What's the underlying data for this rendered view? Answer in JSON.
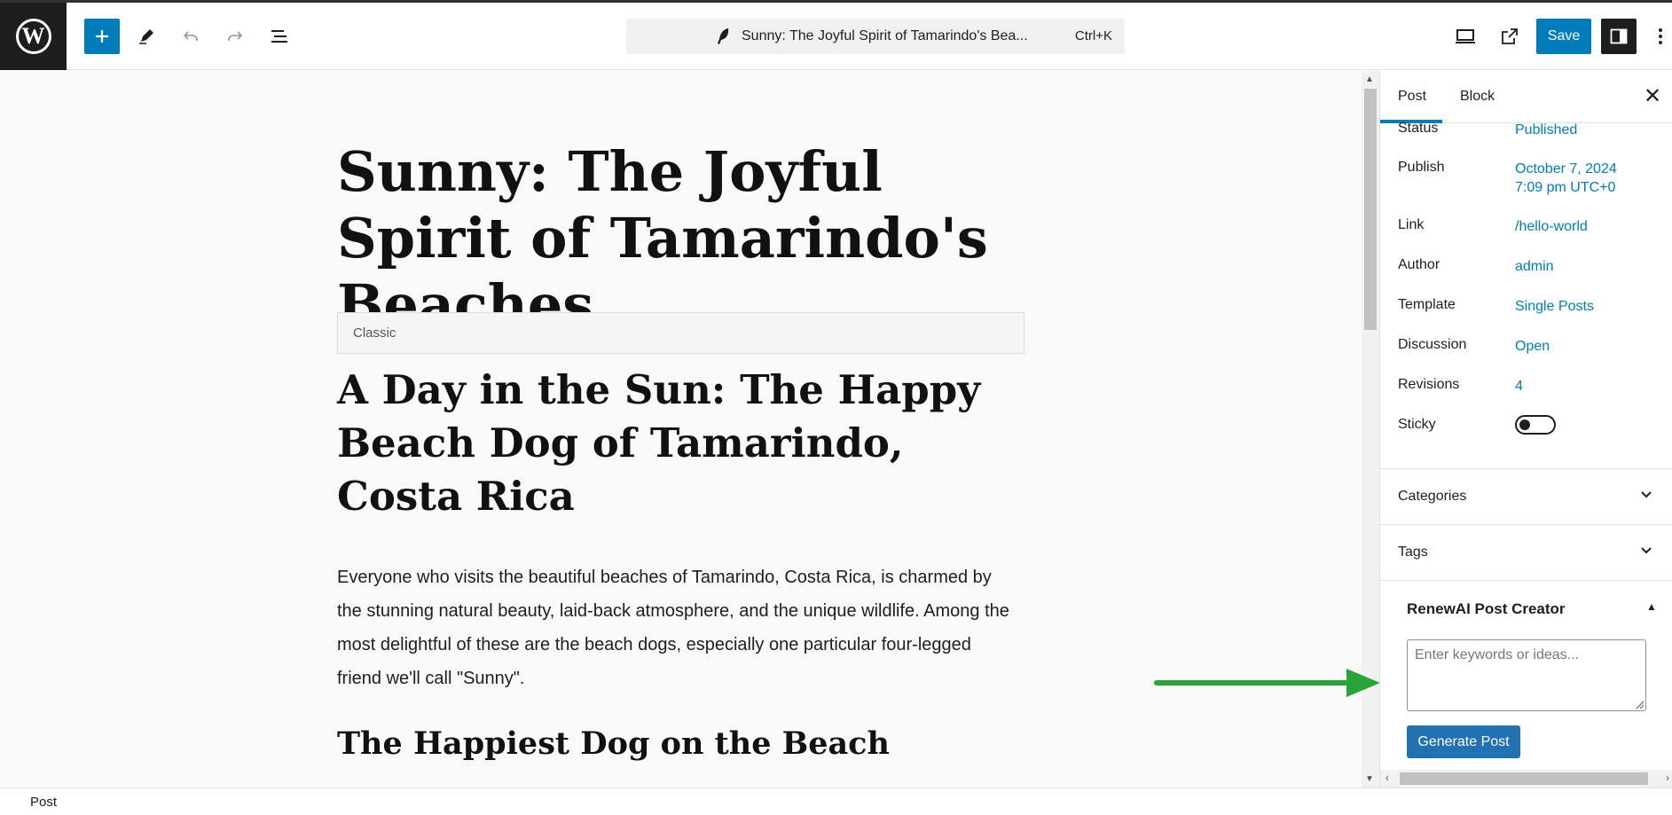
{
  "toolbar": {
    "logo_glyph": "W",
    "command_title": "Sunny: The Joyful Spirit of Tamarindo's Bea...",
    "command_shortcut": "Ctrl+K",
    "save_label": "Save"
  },
  "post": {
    "title": "Sunny: The Joyful Spirit of Tamarindo's Beaches",
    "classic_label": "Classic",
    "heading": "A Day in the Sun: The Happy Beach Dog of Tamarindo, Costa Rica",
    "paragraph": "Everyone who visits the beautiful beaches of Tamarindo, Costa Rica, is charmed by the stunning natural beauty, laid-back atmosphere, and the unique wildlife. Among the most delightful of these are the beach dogs, especially one particular four-legged friend we'll call \"Sunny\".",
    "subheading": "The Happiest Dog on the Beach"
  },
  "sidebar": {
    "tabs": [
      "Post",
      "Block"
    ],
    "active_tab": "Post",
    "summary": {
      "status_label": "Status",
      "status_value": "Published",
      "publish_label": "Publish",
      "publish_date": "October 7, 2024",
      "publish_time": "7:09 pm UTC+0",
      "link_label": "Link",
      "link_value": "/hello-world",
      "author_label": "Author",
      "author_value": "admin",
      "template_label": "Template",
      "template_value": "Single Posts",
      "discussion_label": "Discussion",
      "discussion_value": "Open",
      "revisions_label": "Revisions",
      "revisions_value": "4",
      "sticky_label": "Sticky",
      "sticky_on": false
    },
    "panels": {
      "categories": "Categories",
      "tags": "Tags"
    },
    "renewai": {
      "title": "RenewAI Post Creator",
      "input_placeholder": "Enter keywords or ideas...",
      "input_value": "",
      "generate_label": "Generate Post"
    }
  },
  "footer": {
    "breadcrumb": "Post"
  },
  "colors": {
    "accent": "#007cba",
    "button_blue": "#2271b1",
    "annotation_arrow": "#2aa33a",
    "dark": "#1e1e1e"
  }
}
